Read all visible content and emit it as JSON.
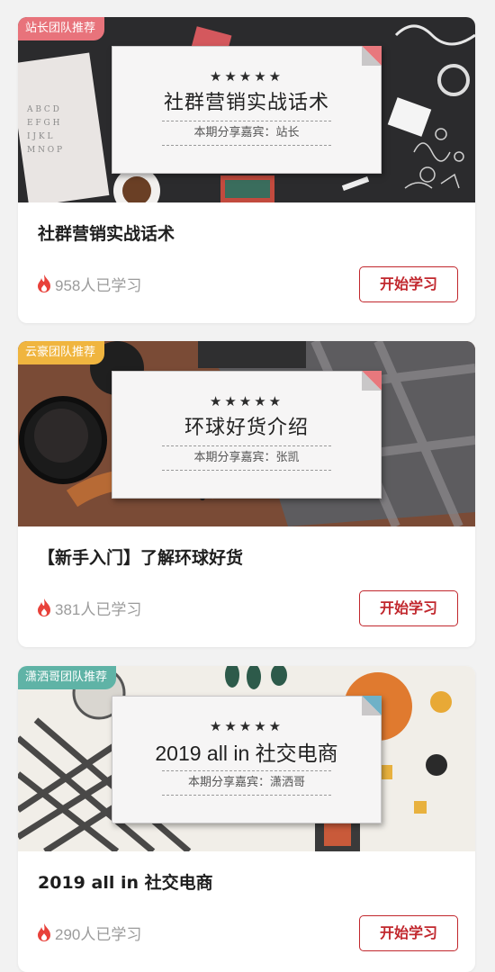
{
  "courses": [
    {
      "tag": "站长团队推荐",
      "tag_color": "#e8737b",
      "banner_stars": "★★★★★",
      "banner_title": "社群营销实战话术",
      "banner_guest": "本期分享嘉宾：站长",
      "title": "社群营销实战话术",
      "learners": "958人已学习",
      "button": "开始学习"
    },
    {
      "tag": "云豪团队推荐",
      "tag_color": "#f0b53f",
      "banner_stars": "★★★★★",
      "banner_title": "环球好货介绍",
      "banner_guest": "本期分享嘉宾：张凯",
      "title": "【新手入门】了解环球好货",
      "learners": "381人已学习",
      "button": "开始学习"
    },
    {
      "tag": "潇洒哥团队推荐",
      "tag_color": "#5fb3a6",
      "banner_stars": "★★★★★",
      "banner_title": "2019 all in 社交电商",
      "banner_guest": "本期分享嘉宾：潇洒哥",
      "title": "2019 all in 社交电商",
      "learners": "290人已学习",
      "button": "开始学习"
    }
  ],
  "accent_color": "#c1272d",
  "flame_icon": "flame-icon"
}
